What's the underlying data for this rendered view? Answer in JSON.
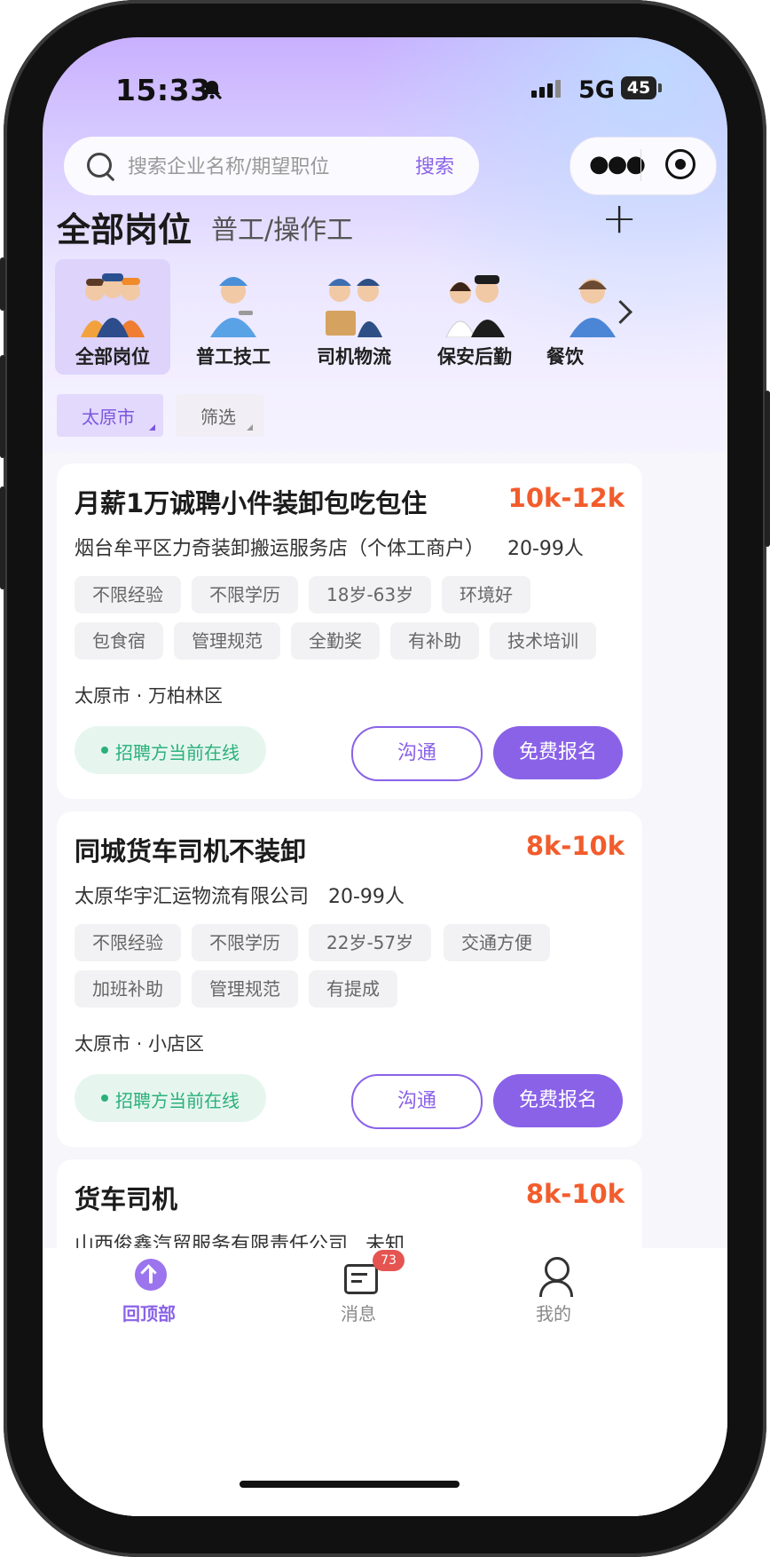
{
  "status_bar": {
    "time": "15:33",
    "network": "5G",
    "battery": "45"
  },
  "search": {
    "placeholder": "搜索企业名称/期望职位",
    "button": "搜索"
  },
  "tabs": {
    "all": "全部岗位",
    "second": "普工/操作工"
  },
  "categories": [
    {
      "label": "全部岗位",
      "active": true
    },
    {
      "label": "普工技工",
      "active": false
    },
    {
      "label": "司机物流",
      "active": false
    },
    {
      "label": "保安后勤",
      "active": false
    },
    {
      "label": "餐饮",
      "active": false
    }
  ],
  "filters": {
    "city": "太原市",
    "filter": "筛选"
  },
  "jobs": [
    {
      "title": "月薪1万诚聘小件装卸包吃包住",
      "salary": "10k-12k",
      "company": "烟台牟平区力奇装卸搬运服务店（个体工商户）",
      "size": "20-99人",
      "tags_row1": [
        "不限经验",
        "不限学历",
        "18岁-63岁",
        "环境好"
      ],
      "tags_row2": [
        "包食宿",
        "管理规范",
        "全勤奖",
        "有补助",
        "技术培训"
      ],
      "location": "太原市 · 万柏林区",
      "online": "招聘方当前在线",
      "chat": "沟通",
      "apply": "免费报名"
    },
    {
      "title": "同城货车司机不装卸",
      "salary": "8k-10k",
      "company": "太原华宇汇运物流有限公司",
      "size": "20-99人",
      "tags_row1": [
        "不限经验",
        "不限学历",
        "22岁-57岁",
        "交通方便"
      ],
      "tags_row2": [
        "加班补助",
        "管理规范",
        "有提成"
      ],
      "location": "太原市 · 小店区",
      "online": "招聘方当前在线",
      "chat": "沟通",
      "apply": "免费报名"
    },
    {
      "title": "货车司机",
      "salary": "8k-10k",
      "company": "山西俊鑫汽贸服务有限责任公司",
      "size": "未知"
    }
  ],
  "tabbar": {
    "top": "回顶部",
    "messages": "消息",
    "messages_badge": "73",
    "me": "我的"
  },
  "colors": {
    "accent": "#8a62e8",
    "salary": "#f25c2c",
    "online": "#2bb07a"
  }
}
